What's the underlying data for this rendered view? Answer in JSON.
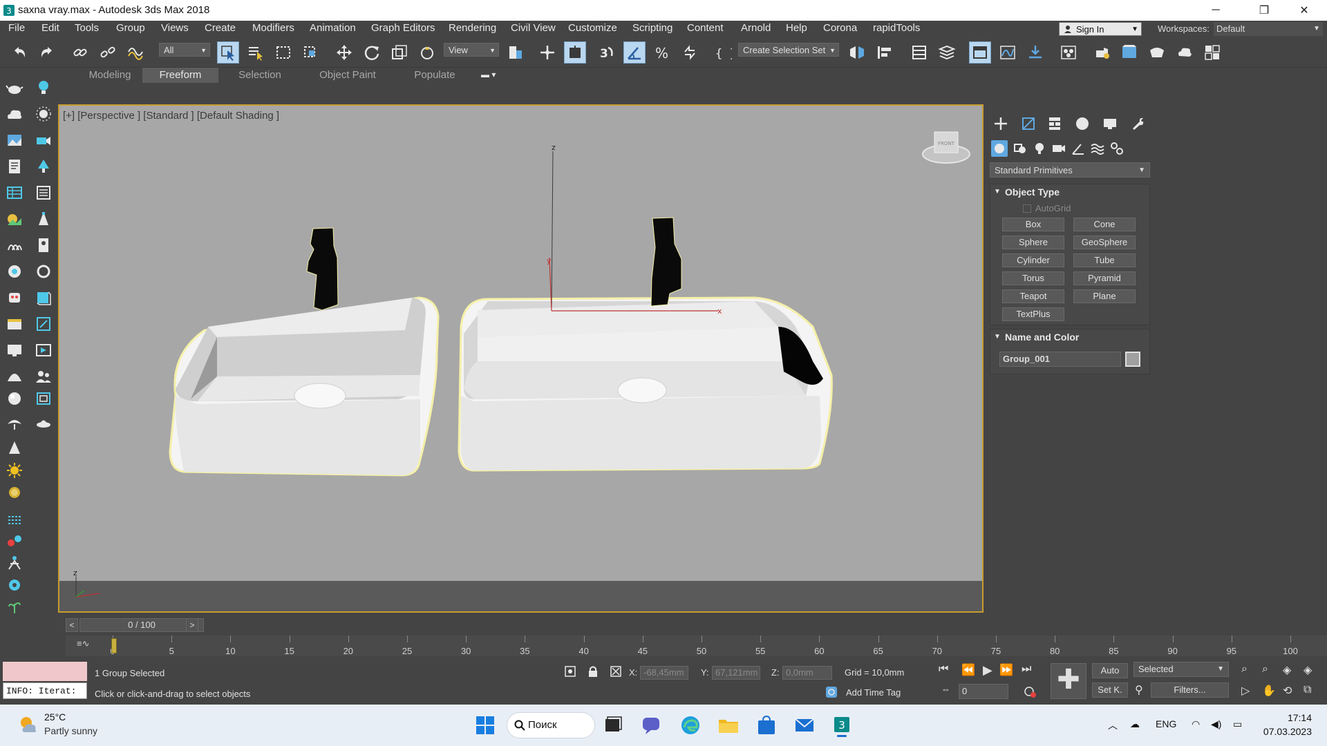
{
  "window": {
    "title": "saxna vray.max - Autodesk 3ds Max 2018",
    "minimize_glyph": "─",
    "restore_glyph": "❐",
    "close_glyph": "✕"
  },
  "menu": {
    "items": [
      "File",
      "Edit",
      "Tools",
      "Group",
      "Views",
      "Create",
      "Modifiers",
      "Animation",
      "Graph Editors",
      "Rendering",
      "Civil View",
      "Customize",
      "Scripting",
      "Content",
      "Arnold",
      "Help",
      "Corona",
      "rapidTools"
    ],
    "sign_in": "Sign In",
    "workspaces_label": "Workspaces:",
    "workspace_value": "Default"
  },
  "toolbar": {
    "selection_filter": "All",
    "reference_coord": "View",
    "named_selection": "Create Selection Set"
  },
  "ribbon": {
    "tabs": [
      "Modeling",
      "Freeform",
      "Selection",
      "Object Paint",
      "Populate"
    ],
    "active_tab": "Freeform"
  },
  "viewport": {
    "label": "[+] [Perspective ] [Standard ] [Default Shading ]",
    "gizmo_axes": {
      "z": "z",
      "y": "y",
      "x": "x"
    },
    "world_axis": {
      "z": "z"
    },
    "viewcube_label": "FRONT"
  },
  "command_panel": {
    "category": "Standard Primitives",
    "object_type_title": "Object Type",
    "autogrid_label": "AutoGrid",
    "buttons": [
      "Box",
      "Cone",
      "Sphere",
      "GeoSphere",
      "Cylinder",
      "Tube",
      "Torus",
      "Pyramid",
      "Teapot",
      "Plane",
      "TextPlus"
    ],
    "name_and_color_title": "Name and Color",
    "object_name": "Group_001",
    "object_color": "#a0a0a0"
  },
  "timeline": {
    "frame_display": "0 / 100",
    "prev_glyph": "<",
    "next_glyph": ">",
    "ticks": [
      "0",
      "5",
      "10",
      "15",
      "20",
      "25",
      "30",
      "35",
      "40",
      "45",
      "50",
      "55",
      "60",
      "65",
      "70",
      "75",
      "80",
      "85",
      "90",
      "95",
      "100"
    ]
  },
  "status": {
    "maxscript_info": "INFO: Iterat:",
    "selection_status": "1 Group Selected",
    "prompt": "Click or click-and-drag to select objects",
    "x_label": "X:",
    "x_value": "-68,45mm",
    "y_label": "Y:",
    "y_value": "67,121mm",
    "z_label": "Z:",
    "z_value": "0,0mm",
    "grid": "Grid = 10,0mm",
    "add_time_tag": "Add Time Tag",
    "auto_key": "Auto",
    "set_key": "Set K.",
    "key_filter_value": "Selected",
    "filters": "Filters...",
    "current_frame": "0"
  },
  "taskbar": {
    "temperature": "25°C",
    "condition": "Partly sunny",
    "search": "Поиск",
    "language": "ENG",
    "time": "17:14",
    "date": "07.03.2023"
  },
  "colors": {
    "ui_bg": "#444444",
    "viewport_bg": "#a7a7a7",
    "viewport_border": "#c89c2e",
    "active_button": "#b9d7f0",
    "selection_outline": "#f5f0a8"
  }
}
